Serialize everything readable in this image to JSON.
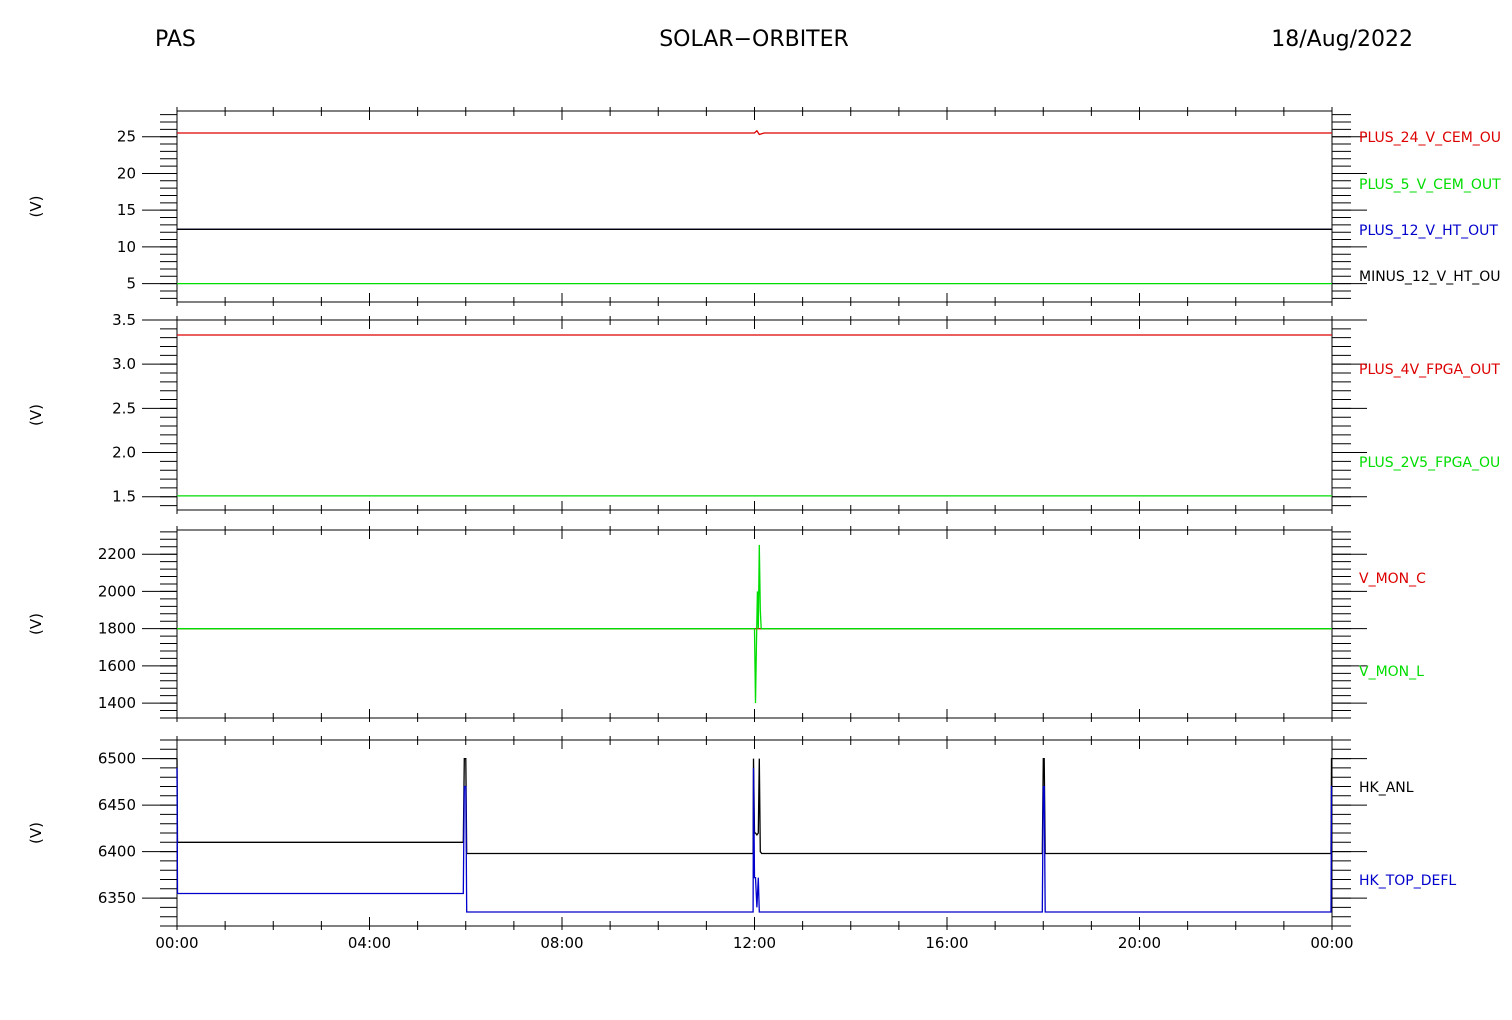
{
  "header": {
    "left": "PAS",
    "center": "SOLAR−ORBITER",
    "right": "18/Aug/2022"
  },
  "colors": {
    "red": "#dd0000",
    "green": "#00dd00",
    "blue": "#0000cc",
    "black": "#000000"
  },
  "chart_data": [
    {
      "type": "line",
      "ylabel": "(V)",
      "ylim": [
        2.5,
        28.5
      ],
      "yticks": [
        5,
        10,
        15,
        20,
        25
      ],
      "yticklabels": [
        "5",
        "10",
        "15",
        "20",
        "25"
      ],
      "yminor": 1,
      "xlim_hours": [
        0,
        24
      ],
      "series": [
        {
          "name": "PLUS_24_V_CEM_OU",
          "color": "#dd0000",
          "x": [
            0,
            12.0,
            12.05,
            12.1,
            12.2,
            24
          ],
          "y": [
            25.5,
            25.5,
            25.8,
            25.3,
            25.5,
            25.5
          ]
        },
        {
          "name": "PLUS_5_V_CEM_OUT",
          "color": "#00dd00",
          "x": [
            0,
            24
          ],
          "y": [
            5.0,
            5.0
          ]
        },
        {
          "name": "PLUS_12_V_HT_OUT",
          "color": "#0000cc",
          "x": [
            0,
            24
          ],
          "y": [
            12.4,
            12.4
          ]
        },
        {
          "name": "MINUS_12_V_HT_OU",
          "color": "#000000",
          "x": [
            0,
            24
          ],
          "y": [
            12.4,
            12.4
          ]
        }
      ]
    },
    {
      "type": "line",
      "ylabel": "(V)",
      "ylim": [
        1.35,
        3.5
      ],
      "yticks": [
        1.5,
        2.0,
        2.5,
        3.0,
        3.5
      ],
      "yticklabels": [
        "1.5",
        "2.0",
        "2.5",
        "3.0",
        "3.5"
      ],
      "yminor": 0.1,
      "xlim_hours": [
        0,
        24
      ],
      "series": [
        {
          "name": "PLUS_4V_FPGA_OUT",
          "color": "#dd0000",
          "x": [
            0,
            24
          ],
          "y": [
            3.33,
            3.33
          ]
        },
        {
          "name": "PLUS_2V5_FPGA_OU",
          "color": "#00dd00",
          "x": [
            0,
            24
          ],
          "y": [
            1.51,
            1.51
          ]
        }
      ]
    },
    {
      "type": "line",
      "ylabel": "(V)",
      "ylim": [
        1320,
        2330
      ],
      "yticks": [
        1400,
        1600,
        1800,
        2000,
        2200
      ],
      "yticklabels": [
        "1400",
        "1600",
        "1800",
        "2000",
        "2200"
      ],
      "yminor": 40,
      "xlim_hours": [
        0,
        24
      ],
      "series": [
        {
          "name": "V_MON_C",
          "color": "#dd0000",
          "x": [
            0,
            24
          ],
          "y": [
            1800,
            1800
          ]
        },
        {
          "name": "V_MON_L",
          "color": "#00dd00",
          "x": [
            0,
            12.0,
            12.02,
            12.04,
            12.06,
            12.08,
            12.1,
            12.12,
            12.14,
            12.16,
            24
          ],
          "y": [
            1800,
            1800,
            1400,
            1700,
            2000,
            1800,
            2250,
            1900,
            1800,
            1800,
            1800
          ]
        }
      ]
    },
    {
      "type": "line",
      "ylabel": "(V)",
      "ylim": [
        6320,
        6520
      ],
      "yticks": [
        6350,
        6400,
        6450,
        6500
      ],
      "yticklabels": [
        "6350",
        "6400",
        "6450",
        "6500"
      ],
      "yminor": 10,
      "xlim_hours": [
        0,
        24
      ],
      "xticks_hours": [
        0,
        4,
        8,
        12,
        16,
        20,
        24
      ],
      "xticklabels": [
        "00:00",
        "04:00",
        "08:00",
        "12:00",
        "16:00",
        "20:00",
        "00:00"
      ],
      "series": [
        {
          "name": "HK_ANL",
          "color": "#000000",
          "x": [
            0,
            0.01,
            0.02,
            5.95,
            5.97,
            6.0,
            6.02,
            11.97,
            11.98,
            12.0,
            12.02,
            12.05,
            12.08,
            12.1,
            12.12,
            12.15,
            12.18,
            17.98,
            18.0,
            18.02,
            18.04,
            23.98,
            23.99,
            24
          ],
          "y": [
            6500,
            6410,
            6410,
            6410,
            6500,
            6500,
            6398,
            6398,
            6500,
            6420,
            6420,
            6418,
            6420,
            6500,
            6400,
            6398,
            6398,
            6398,
            6500,
            6500,
            6398,
            6398,
            6500,
            6500
          ]
        },
        {
          "name": "HK_TOP_DEFL",
          "color": "#0000cc",
          "x": [
            0,
            0.01,
            0.02,
            5.95,
            5.97,
            6.0,
            6.02,
            11.97,
            11.98,
            12.0,
            12.02,
            12.05,
            12.08,
            12.1,
            12.12,
            12.15,
            12.18,
            17.98,
            18.0,
            18.02,
            18.04,
            23.98,
            23.99,
            24
          ],
          "y": [
            6490,
            6355,
            6355,
            6355,
            6470,
            6470,
            6335,
            6335,
            6490,
            6372,
            6372,
            6340,
            6372,
            6335,
            6335,
            6335,
            6335,
            6335,
            6470,
            6470,
            6335,
            6335,
            6470,
            6470
          ]
        }
      ]
    }
  ]
}
